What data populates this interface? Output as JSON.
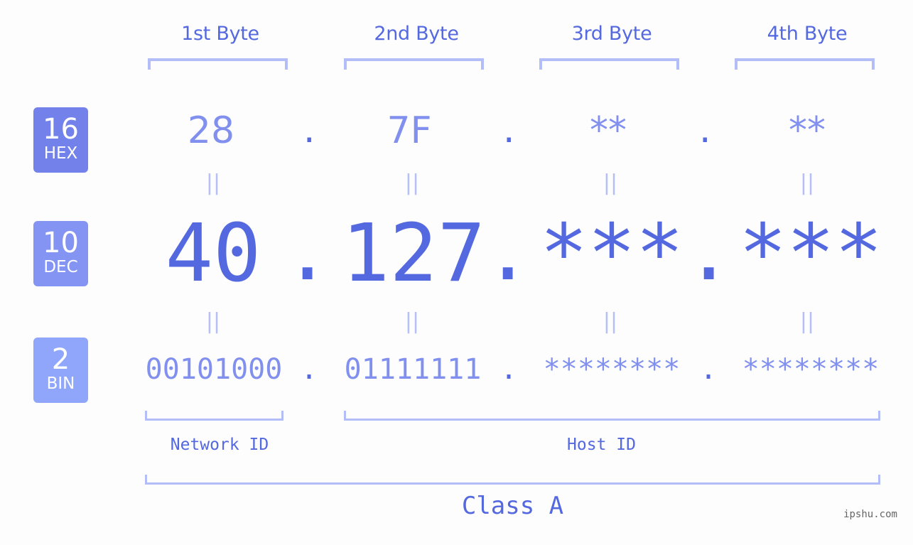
{
  "colors": {
    "accent": "#5468e0",
    "value_light": "#8190ee",
    "bracket": "#b3bdf8",
    "equals": "#b6c0f6",
    "badge_hex": "#7282ea",
    "badge_dec": "#8494f2",
    "badge_bin": "#8fa6fa"
  },
  "bytes": [
    {
      "label": "1st Byte",
      "hex": "28",
      "dec": "40",
      "bin": "00101000"
    },
    {
      "label": "2nd Byte",
      "hex": "7F",
      "dec": "127",
      "bin": "01111111"
    },
    {
      "label": "3rd Byte",
      "hex": "**",
      "dec": "***",
      "bin": "********"
    },
    {
      "label": "4th Byte",
      "hex": "**",
      "dec": "***",
      "bin": "********"
    }
  ],
  "separator": ".",
  "equals_sign": "||",
  "badges": {
    "hex": {
      "number": "16",
      "label": "HEX"
    },
    "dec": {
      "number": "10",
      "label": "DEC"
    },
    "bin": {
      "number": "2",
      "label": "BIN"
    }
  },
  "segments": {
    "network": "Network ID",
    "host": "Host ID"
  },
  "class_label": "Class A",
  "watermark": "ipshu.com"
}
